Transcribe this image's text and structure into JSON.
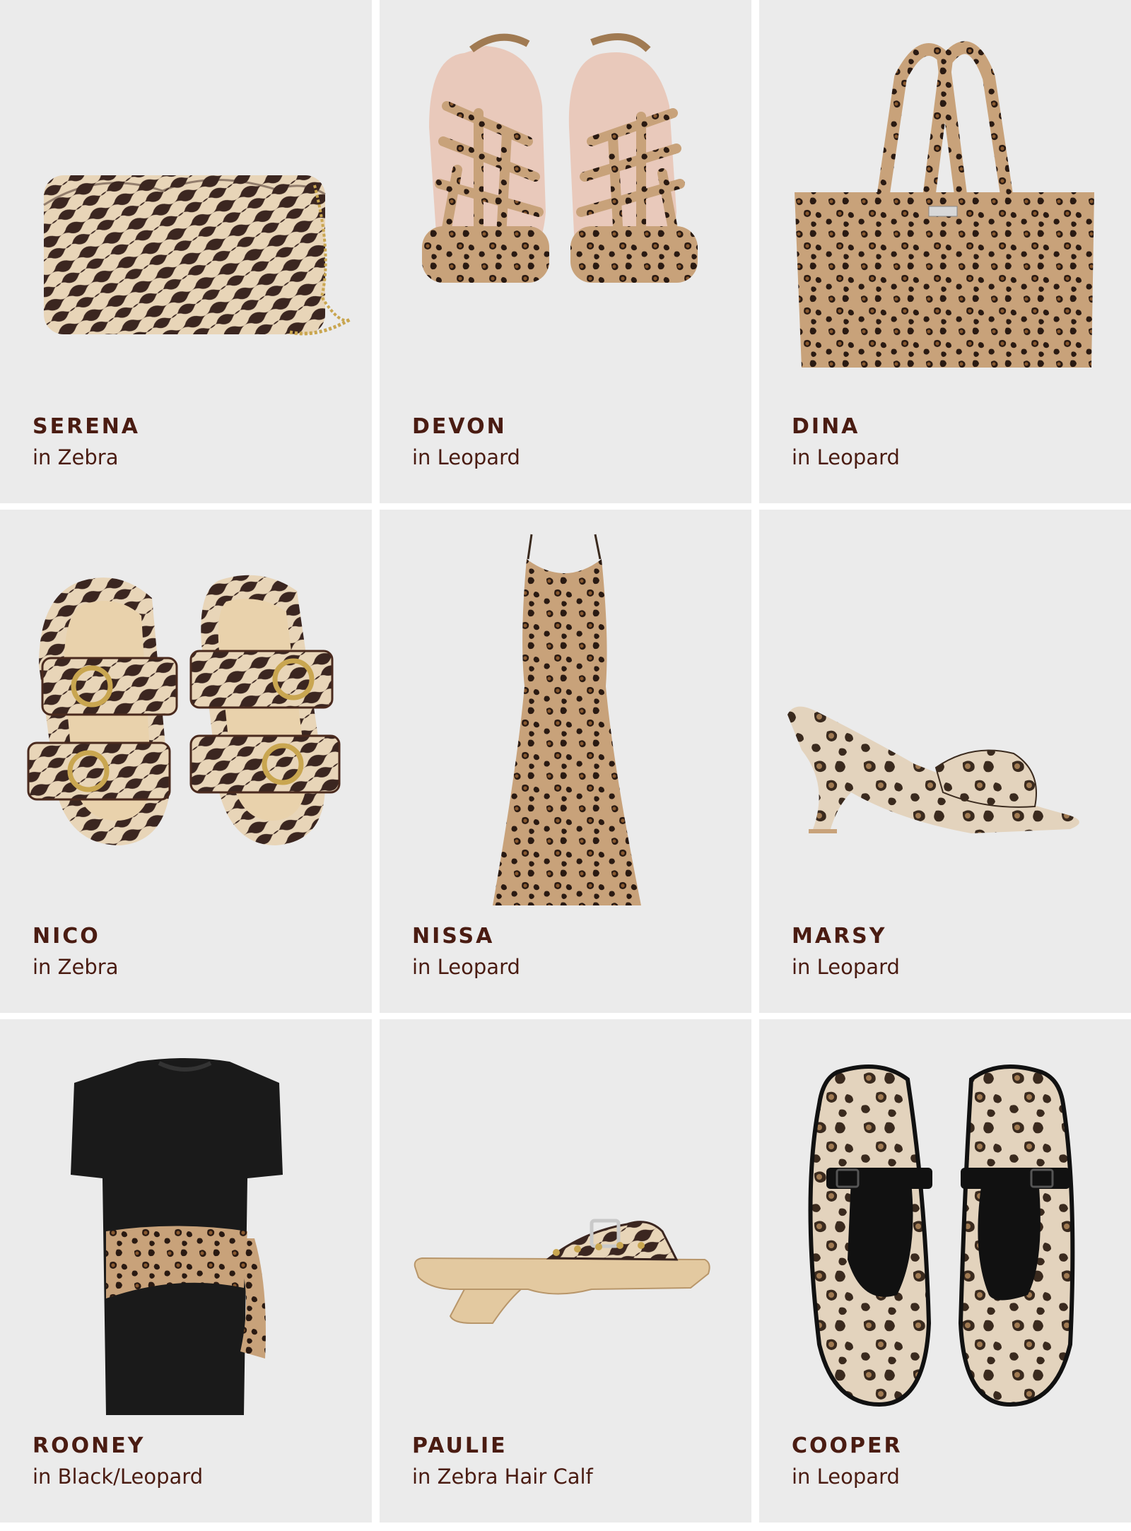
{
  "products": [
    {
      "name": "SERENA",
      "color": "in Zebra",
      "icon": "zebra-clutch-bag-icon"
    },
    {
      "name": "DEVON",
      "color": "in Leopard",
      "icon": "leopard-strappy-sandal-icon"
    },
    {
      "name": "DINA",
      "color": "in Leopard",
      "icon": "leopard-tote-bag-icon"
    },
    {
      "name": "NICO",
      "color": "in Zebra",
      "icon": "zebra-buckle-slide-icon"
    },
    {
      "name": "NISSA",
      "color": "in Leopard",
      "icon": "leopard-slip-dress-icon"
    },
    {
      "name": "MARSY",
      "color": "in Leopard",
      "icon": "leopard-wedge-mule-icon"
    },
    {
      "name": "ROONEY",
      "color": "in Black/Leopard",
      "icon": "black-tshirt-dress-icon"
    },
    {
      "name": "PAULIE",
      "color": "in Zebra Hair Calf",
      "icon": "zebra-clog-sandal-icon"
    },
    {
      "name": "COOPER",
      "color": "in Leopard",
      "icon": "leopard-mary-jane-icon"
    }
  ],
  "colors": {
    "label_text": "#4a1c12",
    "cell_bg": "#ebebeb",
    "gutter": "#ffffff",
    "zebra_base": "#e8d5b8",
    "zebra_stripe": "#3b2620",
    "leopard_base": "#c8a27a",
    "leopard_spot": "#2a1a12",
    "black": "#1a1a1a",
    "wood": "#e3c9a0",
    "gold": "#c9a650"
  }
}
